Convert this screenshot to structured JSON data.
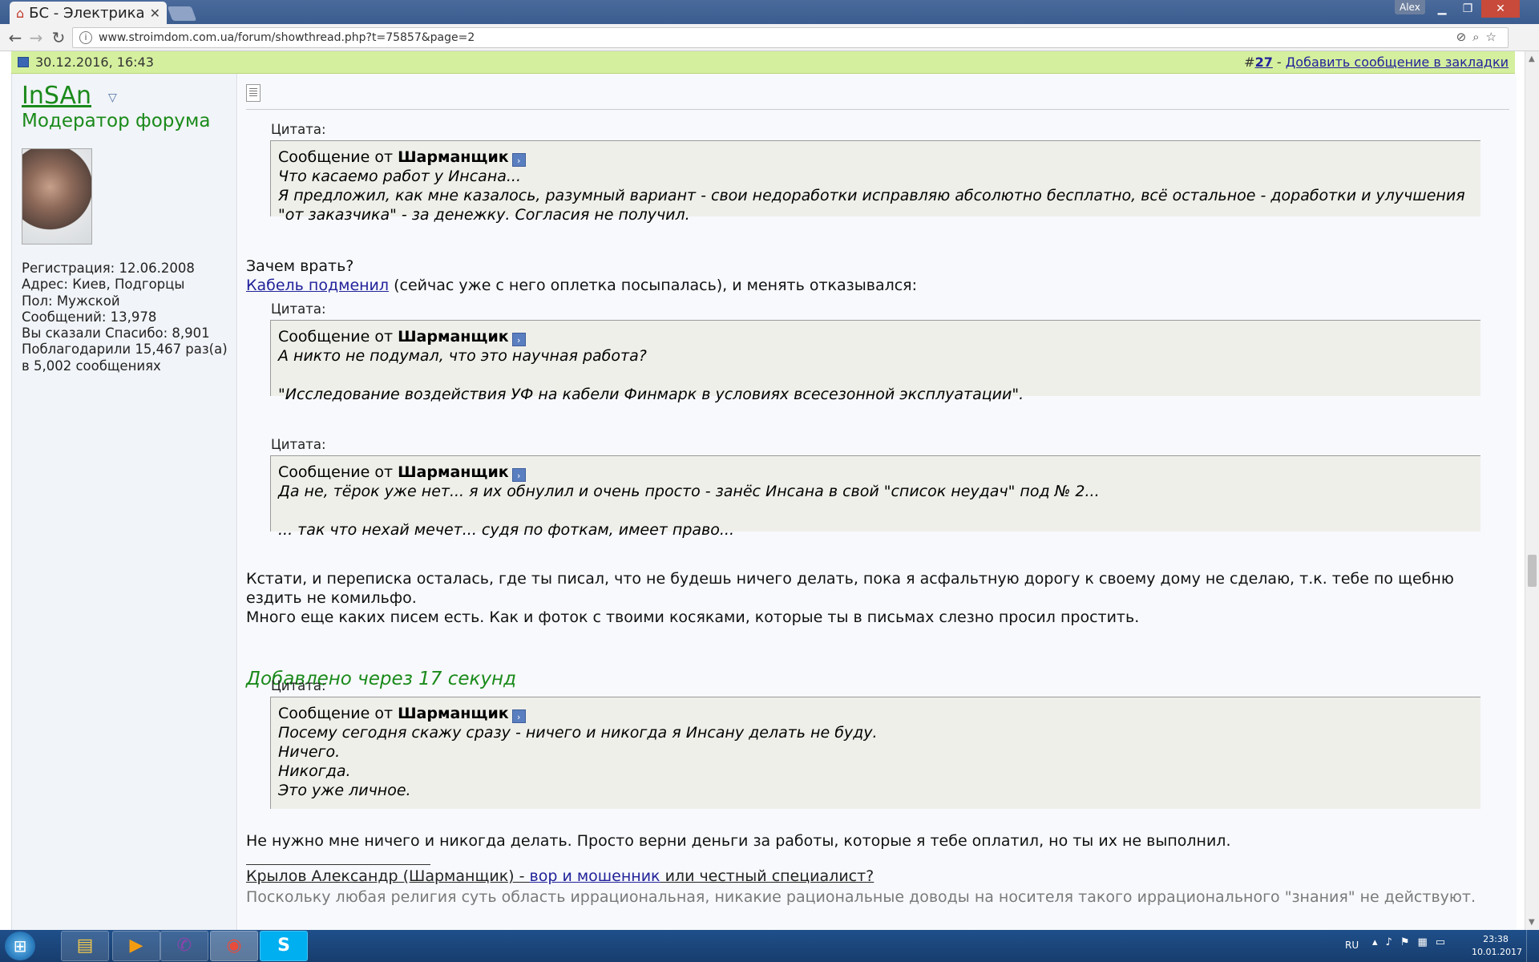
{
  "browser": {
    "tab_title": "БС - Электрика",
    "tab_close": "✕",
    "profile_name": "Alex",
    "url": "www.stroimdom.com.ua/forum/showthread.php?t=75857&page=2"
  },
  "post": {
    "date": "30.12.2016, 16:43",
    "hash": "#",
    "number": "27",
    "separator": " - ",
    "bookmark_link": "Добавить сообщение в закладки"
  },
  "user": {
    "name": "InSAn",
    "title": "Модератор форума",
    "stats": [
      "Регистрация: 12.06.2008",
      "Адрес: Киев, Подгорцы",
      "Пол: Мужской",
      "Сообщений: 13,978",
      "Вы сказали Спасибо: 8,901",
      "Поблагодарили 15,467 раз(а)",
      "в 5,002 сообщениях"
    ]
  },
  "content": {
    "quote_label": "Цитата:",
    "message_from": "Сообщение от ",
    "author": "Шарманщик",
    "quote1_text": "Что касаемо работ у Инсана...\nЯ предложил, как мне казалось, разумный вариант - свои недоработки исправляю абсолютно бесплатно, всё остальное - доработки и улучшения \"от заказчика\" - за денежку. Согласия не получил.",
    "para1_line1": "Зачем врать?",
    "para1_link": "Кабель подменил",
    "para1_rest": " (сейчас уже с него оплетка посыпалась), и менять отказывался:",
    "quote2_text": "А никто не подумал, что это научная работа?\n\n\"Исследование воздействия УФ на кабели Финмарк в условиях всесезонной эксплуатации\".",
    "quote3_text": "Да не, тёрок уже нет... я их обнулил и очень просто - занёс Инсана в свой \"список неудач\" под № 2...\n\n... так что нехай мечет... судя по фоткам, имеет право...",
    "para2": "Кстати, и переписка осталась, где ты писал, что не будешь ничего делать, пока я асфальтную дорогу к своему дому не сделаю, т.к. тебе по щебню ездить не комильфо.",
    "para3": "Много еще каких писем есть. Как и фоток с твоими косяками, которые ты в письмах слезно просил простить.",
    "added_note": "Добавлено через 17 секунд",
    "quote4_text": "Посему сегодня скажу сразу - ничего и никогда я Инсану делать не буду.\nНичего.\nНикогда.\nЭто уже личное.",
    "para4": "Не нужно мне ничего и никогда делать. Просто верни деньги за работы, которые я тебе оплатил, но ты их не выполнил."
  },
  "signature": {
    "part1": "Крылов Александр (Шарманщик) - ",
    "part2": "вор и мошенник",
    "part3": " или честный специалист?",
    "text": "Поскольку любая религия суть область иррациональная, никакие рациональные доводы на носителя такого иррационального \"знания\" не действуют."
  },
  "taskbar": {
    "lang": "RU",
    "time": "23:38",
    "date": "10.01.2017"
  },
  "colors": {
    "post_header_bg": "#d4ef9e",
    "username_green": "#1a8a1a",
    "link_blue": "#22229a",
    "quote_bg": "#efefea"
  }
}
